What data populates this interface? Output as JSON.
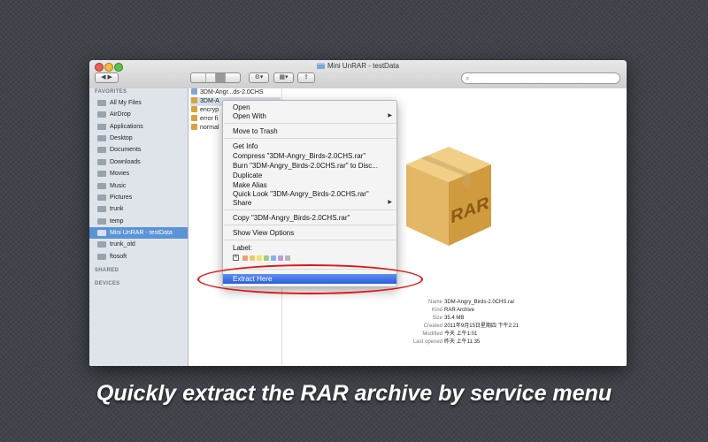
{
  "window": {
    "title": "Mini UnRAR - testData"
  },
  "toolbar": {
    "back_forward": "◀ ▶",
    "action_label": "⚙▾",
    "arrange_label": "▦▾",
    "share_label": "⇪"
  },
  "sidebar": {
    "favorites_heading": "FAVORITES",
    "items": [
      {
        "label": "All My Files"
      },
      {
        "label": "AirDrop"
      },
      {
        "label": "Applications"
      },
      {
        "label": "Desktop"
      },
      {
        "label": "Documents"
      },
      {
        "label": "Downloads"
      },
      {
        "label": "Movies"
      },
      {
        "label": "Music"
      },
      {
        "label": "Pictures"
      },
      {
        "label": "trunk"
      },
      {
        "label": "temp"
      },
      {
        "label": "Mini UnRAR - testData"
      },
      {
        "label": "trunk_old"
      },
      {
        "label": "ftosoft"
      }
    ],
    "shared_heading": "SHARED",
    "devices_heading": "DEVICES"
  },
  "column": {
    "rows": [
      {
        "label": "3DM-Angr...ds-2.0CHS",
        "kind": "folder"
      },
      {
        "label": "3DM-A",
        "kind": "rar"
      },
      {
        "label": "encryp",
        "kind": "rar"
      },
      {
        "label": "error fi",
        "kind": "rar"
      },
      {
        "label": "normal",
        "kind": "rar"
      }
    ]
  },
  "menu": {
    "open": "Open",
    "open_with": "Open With",
    "move_to_trash": "Move to Trash",
    "get_info": "Get Info",
    "compress": "Compress \"3DM-Angry_Birds-2.0CHS.rar\"",
    "burn": "Burn \"3DM-Angry_Birds-2.0CHS.rar\" to Disc...",
    "duplicate": "Duplicate",
    "make_alias": "Make Alias",
    "quick_look": "Quick Look \"3DM-Angry_Birds-2.0CHS.rar\"",
    "share": "Share",
    "copy": "Copy \"3DM-Angry_Birds-2.0CHS.rar\"",
    "show_view_options": "Show View Options",
    "label": "Label:",
    "label_none": "×",
    "label_colors": [
      "#e8a070",
      "#f1c95e",
      "#f3e36a",
      "#9ed07a",
      "#86b2ea",
      "#c09ae0",
      "#b6b6b6"
    ],
    "extract_here": "Extract Here"
  },
  "preview": {
    "badge_text": "RAR",
    "info": [
      {
        "key": "Name",
        "value": "3DM-Angry_Birds-2.0CHS.rar"
      },
      {
        "key": "Kind",
        "value": "RAR Archive"
      },
      {
        "key": "Size",
        "value": "35.4 MB"
      },
      {
        "key": "Created",
        "value": "2011年9月15日星期四 下午2:21"
      },
      {
        "key": "Modified",
        "value": "今天 上午1:01"
      },
      {
        "key": "Last opened",
        "value": "昨天 上午11:35"
      }
    ]
  },
  "caption": "Quickly extract the RAR archive by service menu",
  "colors": {
    "background": "#3e4248",
    "selection": "#5b93d7",
    "menu_highlight": "#2d5fe0",
    "annotation": "#e01515",
    "box": "#d9a24a"
  }
}
